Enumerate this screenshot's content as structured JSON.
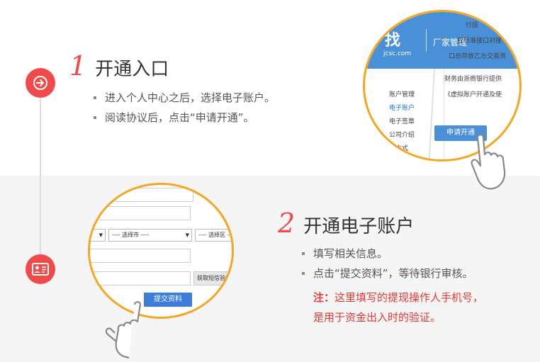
{
  "step1": {
    "number": "1",
    "title": "开通入口",
    "bullets": [
      "进入个人中心之后，选择电子账户。",
      "阅读协议后，点击“申请开通”。"
    ],
    "illustration": {
      "brand": "找",
      "brand_domain": "jcsc.com",
      "header_tab": "厂家管理",
      "menu": [
        "账户管理",
        "电子账户",
        "电子签章",
        "公司介绍",
        "系方式"
      ],
      "right_lines": [
        "行技",
        "权标准接口对接",
        "口总存放乙方交易资",
        "财务由浙商银行提供",
        "《虚拟账户开通及使"
      ],
      "apply_button": "申请开通"
    }
  },
  "step2": {
    "number": "2",
    "title": "开通电子账户",
    "bullets": [
      "填写相关信息。",
      "点击“提交资料”，等待银行审核。"
    ],
    "note_label": "注：",
    "note_line1": "这里填写的提现操作人手机号，",
    "note_line2": "是用于资金出入时的验证。",
    "illustration": {
      "select_city": "---- 选择市 ----",
      "select_district": "---- 选择区 ---",
      "sms_button": "获取短信验证",
      "submit_button": "提交资料"
    }
  },
  "colors": {
    "accent": "#f04a4a",
    "ring": "#f5a623",
    "blue": "#4a90d9"
  }
}
